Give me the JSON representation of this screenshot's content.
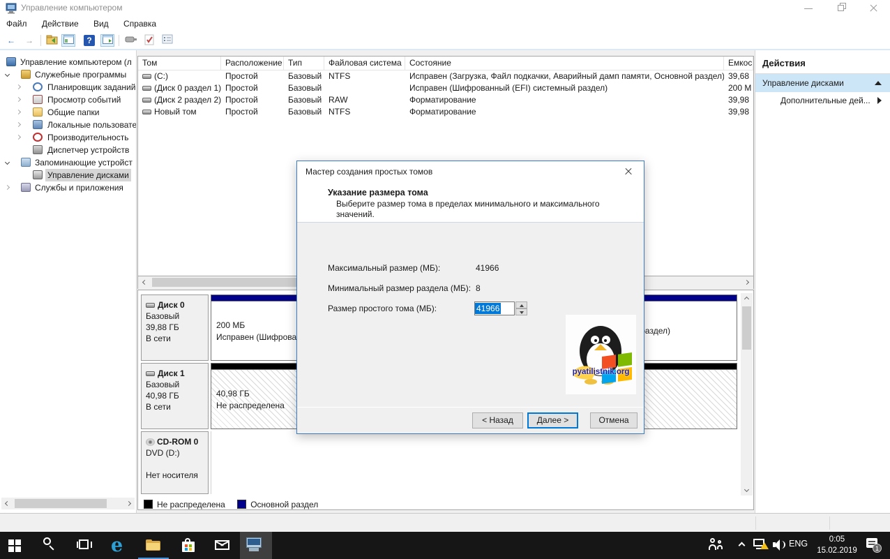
{
  "window": {
    "title": "Управление компьютером"
  },
  "menu": {
    "items": [
      "Файл",
      "Действие",
      "Вид",
      "Справка"
    ]
  },
  "toolbar": {
    "glyphs": {
      "back": "←",
      "forward": "→",
      "help": "?"
    }
  },
  "tree": {
    "items": [
      {
        "label": "Управление компьютером (л",
        "level": 0,
        "icon": "computer"
      },
      {
        "label": "Служебные программы",
        "level": 1,
        "icon": "tools",
        "arrow": "down"
      },
      {
        "label": "Планировщик заданий",
        "level": 2,
        "icon": "task-scheduler",
        "arrow": "right"
      },
      {
        "label": "Просмотр событий",
        "level": 2,
        "icon": "event-viewer",
        "arrow": "right"
      },
      {
        "label": "Общие папки",
        "level": 2,
        "icon": "shared-folders",
        "arrow": "right"
      },
      {
        "label": "Локальные пользовате",
        "level": 2,
        "icon": "local-users",
        "arrow": "right"
      },
      {
        "label": "Производительность",
        "level": 2,
        "icon": "performance",
        "arrow": "right"
      },
      {
        "label": "Диспетчер устройств",
        "level": 2,
        "icon": "device-manager"
      },
      {
        "label": "Запоминающие устройст",
        "level": 1,
        "icon": "storage",
        "arrow": "down"
      },
      {
        "label": "Управление дисками",
        "level": 2,
        "icon": "disk-management",
        "selected": true
      },
      {
        "label": "Службы и приложения",
        "level": 1,
        "icon": "services",
        "arrow": "right"
      }
    ]
  },
  "volumes": {
    "columns": [
      "Том",
      "Расположение",
      "Тип",
      "Файловая система",
      "Состояние",
      "Емкос"
    ],
    "rows": [
      {
        "name": "(C:)",
        "layout": "Простой",
        "type": "Базовый",
        "fs": "NTFS",
        "status": "Исправен (Загрузка, Файл подкачки, Аварийный дамп памяти, Основной раздел)",
        "capacity": "39,68"
      },
      {
        "name": "(Диск 0 раздел 1)",
        "layout": "Простой",
        "type": "Базовый",
        "fs": "",
        "status": "Исправен (Шифрованный (EFI) системный раздел)",
        "capacity": "200 М"
      },
      {
        "name": "(Диск 2 раздел 2)",
        "layout": "Простой",
        "type": "Базовый",
        "fs": "RAW",
        "status": "Форматирование",
        "capacity": "39,98"
      },
      {
        "name": "Новый том",
        "layout": "Простой",
        "type": "Базовый",
        "fs": "NTFS",
        "status": "Форматирование",
        "capacity": "39,98"
      }
    ]
  },
  "actions": {
    "title": "Действия",
    "group": "Управление дисками",
    "more": "Дополнительные дей..."
  },
  "disks": [
    {
      "name": "Диск 0",
      "type": "Базовый",
      "size": "39,88 ГБ",
      "status": "В сети",
      "partitions": [
        {
          "size": "200 МБ",
          "status": "Исправен (Шифрованный (EFI) системный раздел)",
          "color": "#00008b"
        },
        {
          "size": "",
          "status": "Исправен (Загрузка, Файл подкачки, Аварийный дамп памяти, Основной раздел)",
          "color": "#00008b"
        }
      ]
    },
    {
      "name": "Диск 1",
      "type": "Базовый",
      "size": "40,98 ГБ",
      "status": "В сети",
      "partitions": [
        {
          "size": "40,98 ГБ",
          "status": "Не распределена",
          "color": "#000000"
        }
      ]
    },
    {
      "name": "CD-ROM 0",
      "type": "DVD (D:)",
      "size": "",
      "status": "Нет носителя",
      "partitions": []
    }
  ],
  "legend": [
    {
      "label": "Не распределена",
      "color": "#000000"
    },
    {
      "label": "Основной раздел",
      "color": "#00008b"
    }
  ],
  "dialog": {
    "title": "Мастер создания простых томов",
    "heading": "Указание размера тома",
    "subtitle": "Выберите размер тома в пределах минимального и максимального значений.",
    "fields": [
      {
        "label": "Максимальный размер (МБ):",
        "value": "41966"
      },
      {
        "label": "Минимальный размер раздела (МБ):",
        "value": "8"
      },
      {
        "label": "Размер простого тома (МБ):",
        "value": "41966"
      }
    ],
    "buttons": {
      "back": "< Назад",
      "next": "Далее >",
      "cancel": "Отмена"
    }
  },
  "watermark": {
    "text": "pyatilistnik.org"
  },
  "taskbar": {
    "edge_glyph": "e",
    "lang": "ENG",
    "time": "0:05",
    "date": "15.02.2019",
    "badge": "1"
  }
}
